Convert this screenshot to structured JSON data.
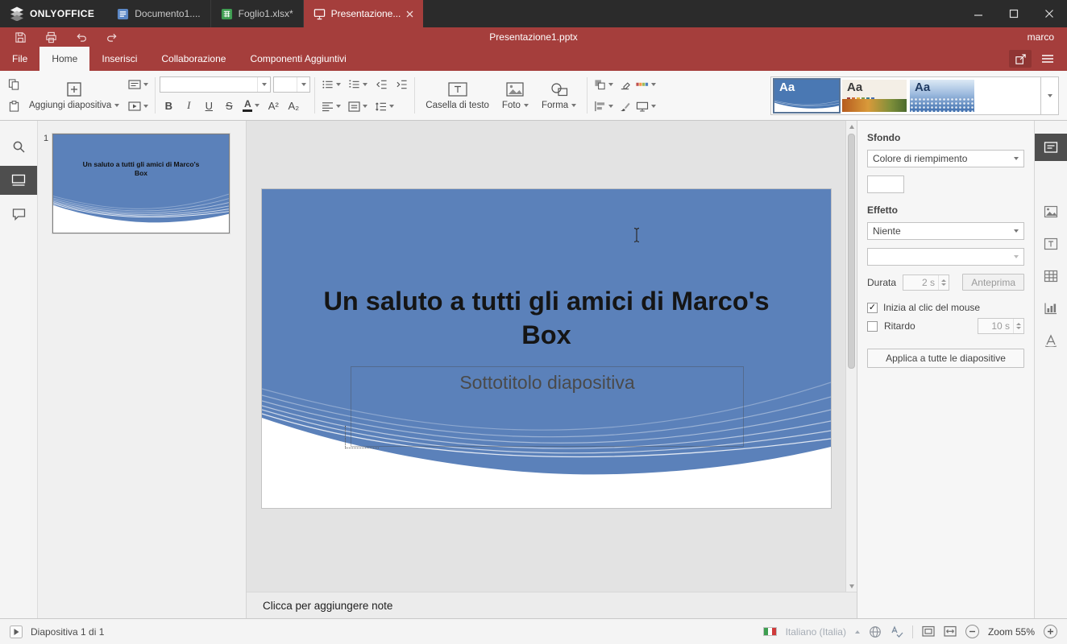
{
  "app": {
    "brand": "ONLYOFFICE",
    "window_tabs": [
      {
        "label": "Documento1...."
      },
      {
        "label": "Foglio1.xlsx*"
      },
      {
        "label": "Presentazione..."
      }
    ]
  },
  "titlebar": {
    "document_title": "Presentazione1.pptx",
    "user": "marco"
  },
  "menu": {
    "file": "File",
    "home": "Home",
    "insert": "Inserisci",
    "collaboration": "Collaborazione",
    "plugins": "Componenti Aggiuntivi"
  },
  "toolbar": {
    "add_slide": "Aggiungi diapositiva",
    "bold": "B",
    "italic": "I",
    "underline": "U",
    "strike": "S",
    "font_color": "A",
    "superscript": "A²",
    "subscript": "A₂",
    "text_box": "Casella di testo",
    "photo": "Foto",
    "shape": "Forma",
    "theme_sample": "Aa"
  },
  "slides_panel": {
    "slide_number": "1"
  },
  "slide": {
    "title": "Un saluto a tutti gli amici di Marco's Box",
    "subtitle": "Sottotitolo diapositiva"
  },
  "notes": {
    "placeholder": "Clicca per aggiungere note"
  },
  "slide_settings": {
    "background_label": "Sfondo",
    "fill_value": "Colore di riempimento",
    "effect_label": "Effetto",
    "effect_value": "Niente",
    "duration_label": "Durata",
    "duration_value": "2 s",
    "preview": "Anteprima",
    "start_on_click": "Inizia al clic del mouse",
    "delay_label": "Ritardo",
    "delay_value": "10 s",
    "apply_all": "Applica a tutte le diapositive"
  },
  "statusbar": {
    "slide_counter": "Diapositiva 1 di 1",
    "language": "Italiano (Italia)",
    "zoom": "Zoom 55%"
  },
  "colors": {
    "accent_red": "#A53E3C",
    "slide_blue": "#5B81BA",
    "topbar_dark": "#2B2B2B"
  }
}
